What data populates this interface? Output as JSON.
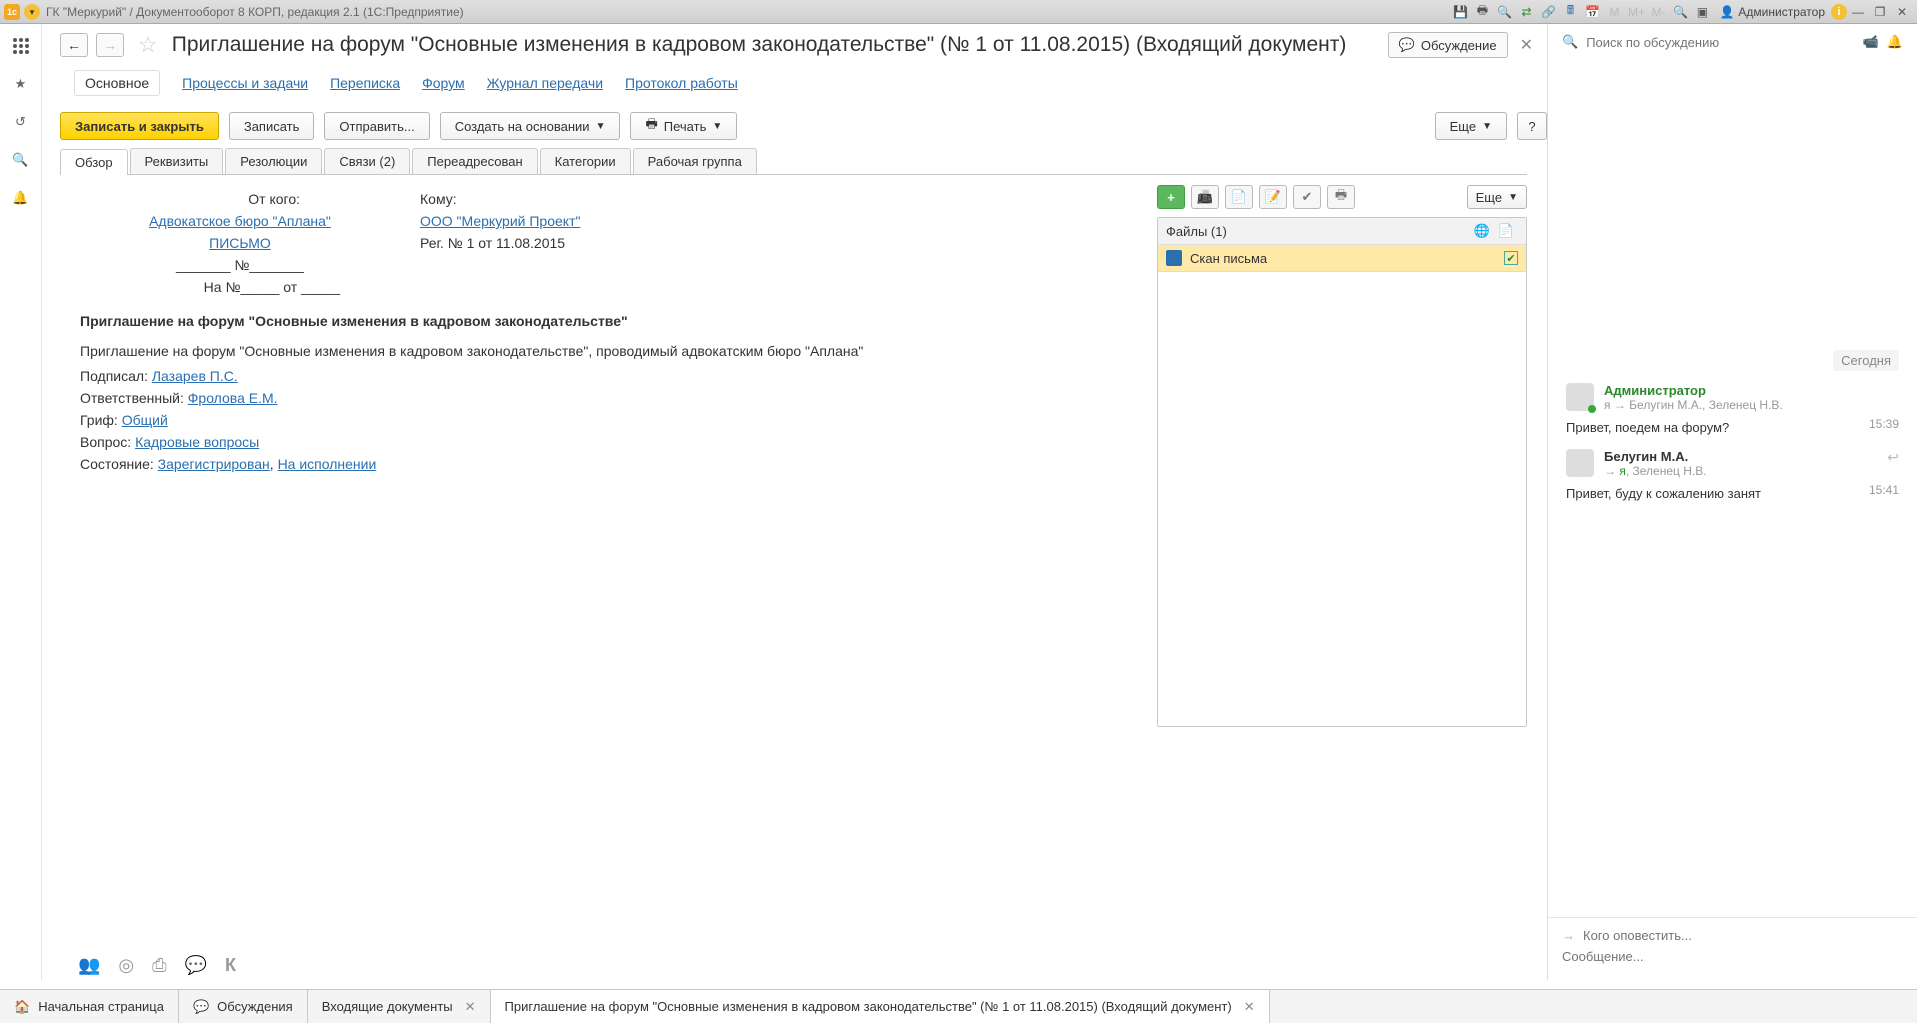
{
  "sysbar": {
    "title": "ГК \"Меркурий\" / Документооборот 8 КОРП, редакция 2.1  (1С:Предприятие)",
    "user": "Администратор"
  },
  "page": {
    "title": "Приглашение на форум \"Основные изменения в кадровом законодательстве\" (№ 1 от 11.08.2015) (Входящий документ)",
    "discussion_btn": "Обсуждение"
  },
  "section_nav": {
    "main": "Основное",
    "processes": "Процессы и задачи",
    "correspondence": "Переписка",
    "forum": "Форум",
    "journal": "Журнал передачи",
    "protocol": "Протокол работы"
  },
  "toolbar": {
    "save_close": "Записать и закрыть",
    "save": "Записать",
    "send": "Отправить...",
    "create_based": "Создать на основании",
    "print": "Печать",
    "more": "Еще",
    "help": "?"
  },
  "tabs": {
    "overview": "Обзор",
    "props": "Реквизиты",
    "resolutions": "Резолюции",
    "relations": "Связи (2)",
    "forwarded": "Переадресован",
    "categories": "Категории",
    "workgroup": "Рабочая группа"
  },
  "doc": {
    "from_lbl": "От кого:",
    "from_val": "Адвокатское бюро \"Аплана\"",
    "to_lbl": "Кому:",
    "to_val": "ООО \"Меркурий Проект\"",
    "type": "ПИСЬМО",
    "reg": "Рег. № 1 от 11.08.2015",
    "num_prefix": "_______ №_______",
    "reply_prefix": "На №_____ от _____",
    "subject": "Приглашение на форум \"Основные изменения в кадровом законодательстве\"",
    "body": "Приглашение на форум \"Основные изменения в кадровом законодательстве\", проводимый адвокатским бюро \"Аплана\"",
    "signed_lbl": "Подписал: ",
    "signed_val": "Лазарев П.С.",
    "resp_lbl": "Ответственный: ",
    "resp_val": "Фролова Е.М.",
    "grif_lbl": "Гриф: ",
    "grif_val": "Общий",
    "question_lbl": "Вопрос: ",
    "question_val": "Кадровые вопросы",
    "state_lbl": "Состояние: ",
    "state_val1": "Зарегистрирован",
    "state_sep": ", ",
    "state_val2": "На исполнении"
  },
  "files": {
    "more": "Еще",
    "header": "Файлы (1)",
    "item": "Скан письма"
  },
  "discussion": {
    "search_placeholder": "Поиск по обсуждению",
    "date": "Сегодня",
    "m1_who": "Администратор",
    "m1_meta_prefix": "я → ",
    "m1_meta_rest": "Белугин М.А., Зеленец Н.В.",
    "m1_text": "Привет, поедем на форум?",
    "m1_time": "15:39",
    "m2_who": "Белугин М.А.",
    "m2_meta_prefix": "→ ",
    "m2_meta_me": "я",
    "m2_meta_rest": ", Зеленец Н.В.",
    "m2_text": "Привет, буду к сожалению занят",
    "m2_time": "15:41",
    "notify_placeholder": "Кого оповестить...",
    "msg_placeholder": "Сообщение..."
  },
  "bottom": {
    "home": "Начальная страница",
    "discussions": "Обсуждения",
    "incoming": "Входящие документы",
    "current": "Приглашение на форум \"Основные изменения в кадровом законодательстве\" (№ 1 от 11.08.2015) (Входящий документ)"
  }
}
